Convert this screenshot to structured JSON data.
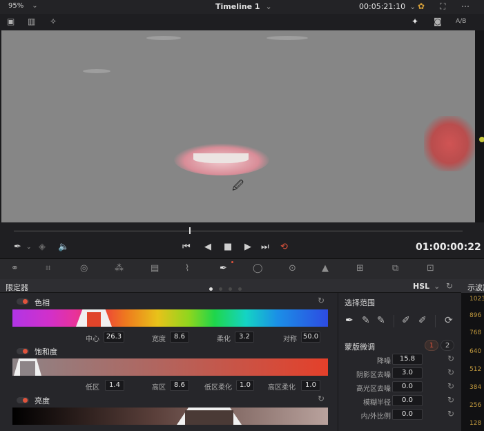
{
  "topbar": {
    "zoom": "95%",
    "timeline_title": "Timeline 1",
    "timecode": "00:05:21:10"
  },
  "viewer_toolbar": {
    "ab_label": "A/B"
  },
  "transport": {
    "timecode": "01:00:00:22"
  },
  "qualifier": {
    "title": "限定器",
    "mode": "HSL",
    "hue": {
      "label": "色相",
      "params": [
        {
          "label": "中心",
          "value": "26.3"
        },
        {
          "label": "宽度",
          "value": "8.6"
        },
        {
          "label": "柔化",
          "value": "3.2"
        },
        {
          "label": "对称",
          "value": "50.0"
        }
      ]
    },
    "saturation": {
      "label": "饱和度",
      "params": [
        {
          "label": "低区",
          "value": "1.4"
        },
        {
          "label": "高区",
          "value": "8.6"
        },
        {
          "label": "低区柔化",
          "value": "1.0"
        },
        {
          "label": "高区柔化",
          "value": "1.0"
        }
      ]
    },
    "luminance": {
      "label": "亮度"
    }
  },
  "selection": {
    "title": "选择范围"
  },
  "matte_finesse": {
    "title": "蒙版微调",
    "mode_1": "1",
    "mode_2": "2",
    "rows": [
      {
        "label": "降噪",
        "value": "15.8"
      },
      {
        "label": "阴影区去噪",
        "value": "3.0"
      },
      {
        "label": "高光区去噪",
        "value": "0.0"
      },
      {
        "label": "模糊半径",
        "value": "0.0"
      },
      {
        "label": "内/外比例",
        "value": "0.0"
      }
    ]
  },
  "scope": {
    "title": "示波器",
    "ticks": [
      "1023",
      "896",
      "768",
      "640",
      "512",
      "384",
      "256",
      "128"
    ]
  }
}
